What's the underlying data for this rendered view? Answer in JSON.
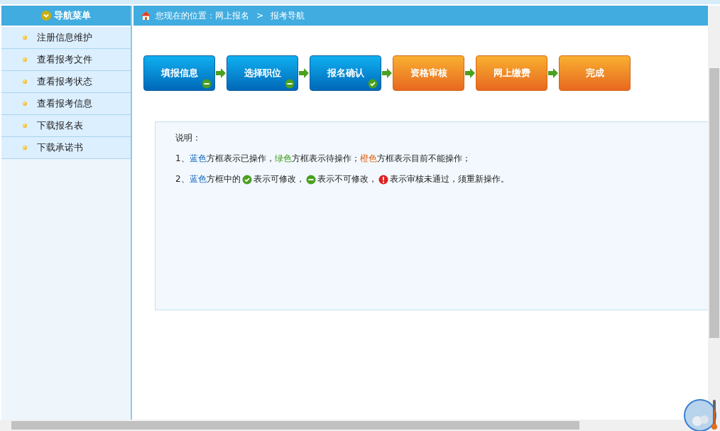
{
  "sidebar": {
    "title": "导航菜单",
    "items": [
      {
        "label": "注册信息维护"
      },
      {
        "label": "查看报考文件"
      },
      {
        "label": "查看报考状态"
      },
      {
        "label": "查看报考信息"
      },
      {
        "label": "下载报名表"
      },
      {
        "label": "下载承诺书"
      }
    ]
  },
  "breadcrumb": {
    "prefix": "您现在的位置：网上报名",
    "separator": ">",
    "current": "报考导航"
  },
  "steps": [
    {
      "label": "填报信息",
      "done": true,
      "editable": false
    },
    {
      "label": "选择职位",
      "done": true,
      "editable": false
    },
    {
      "label": "报名确认",
      "done": true,
      "editable": true
    },
    {
      "label": "资格审核",
      "done": false
    },
    {
      "label": "网上缴费",
      "done": false
    },
    {
      "label": "完成",
      "done": false
    }
  ],
  "notes": {
    "title": "说明：",
    "lines": [
      [
        {
          "kind": "plain",
          "text": "1、"
        },
        {
          "kind": "blue",
          "text": "蓝色"
        },
        {
          "kind": "plain",
          "text": "方框表示已操作，"
        },
        {
          "kind": "green",
          "text": "绿色"
        },
        {
          "kind": "plain",
          "text": "方框表示待操作；"
        },
        {
          "kind": "orange",
          "text": "橙色"
        },
        {
          "kind": "plain",
          "text": "方框表示目前不能操作；"
        }
      ],
      [
        {
          "kind": "plain",
          "text": "2、"
        },
        {
          "kind": "blue",
          "text": "蓝色"
        },
        {
          "kind": "plain",
          "text": "方框中的"
        },
        {
          "kind": "check"
        },
        {
          "kind": "plain",
          "text": "表示可修改，"
        },
        {
          "kind": "minus"
        },
        {
          "kind": "plain",
          "text": "表示不可修改，"
        },
        {
          "kind": "error"
        },
        {
          "kind": "plain",
          "text": "表示审核未通过，须重新操作。"
        }
      ]
    ]
  }
}
